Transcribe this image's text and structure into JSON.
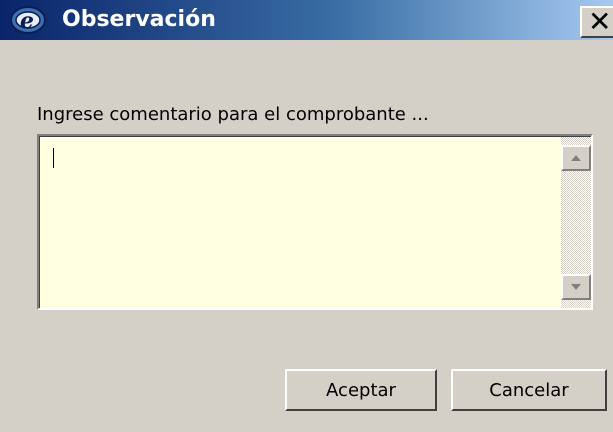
{
  "window": {
    "title": "Observación",
    "app_icon": "e-app-icon",
    "close_icon": "close-icon",
    "close_label": "✕"
  },
  "dialog": {
    "prompt": "Ingrese comentario para el comprobante ...",
    "comment_value": "",
    "comment_background": "#ffffe1"
  },
  "buttons": {
    "ok_label": "Aceptar",
    "cancel_label": "Cancelar"
  },
  "colors": {
    "titlebar_start": "#0a246a",
    "titlebar_end": "#a6caf0",
    "dialog_bg": "#d4d0c8"
  }
}
